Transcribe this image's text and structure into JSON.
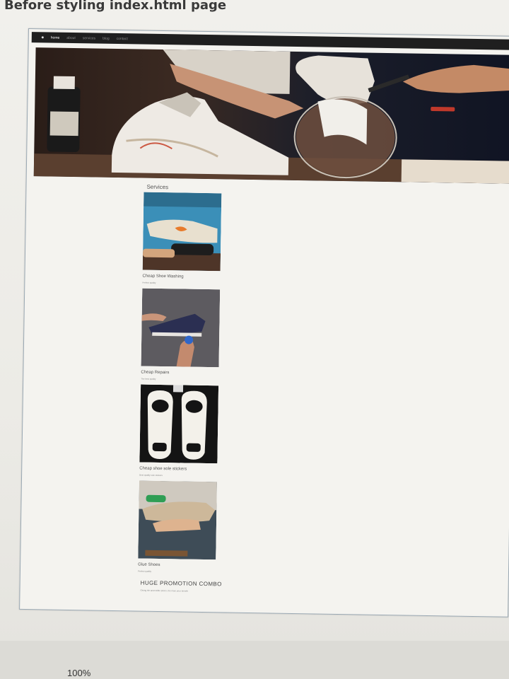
{
  "caption": "Before styling index.html page",
  "nav": {
    "links": [
      "home",
      "about",
      "services",
      "blog",
      "contact"
    ]
  },
  "services": {
    "title": "Services",
    "items": [
      {
        "name": "Cheap Shoe Washing",
        "desc": "Perfect quality",
        "icon": "shoe-washing-photo"
      },
      {
        "name": "Cheap Repairs",
        "desc": "The best quality",
        "icon": "shoe-repair-photo"
      },
      {
        "name": "Cheap shoe sole stickers",
        "desc": "Best quality sole stickers",
        "icon": "sole-stickers-photo"
      },
      {
        "name": "Glue Shoes",
        "desc": "Perfect quality",
        "icon": "glue-shoes-photo"
      }
    ]
  },
  "promo": {
    "title": "HUGE PROMOTION COMBO",
    "desc": "Giving the accessible prices, the more your benefit"
  },
  "zoom": "100%",
  "colors": {
    "nav_bg": "#1f1f1f",
    "page_bg": "#f4f3ef",
    "frame_border": "#9aa8b3"
  }
}
